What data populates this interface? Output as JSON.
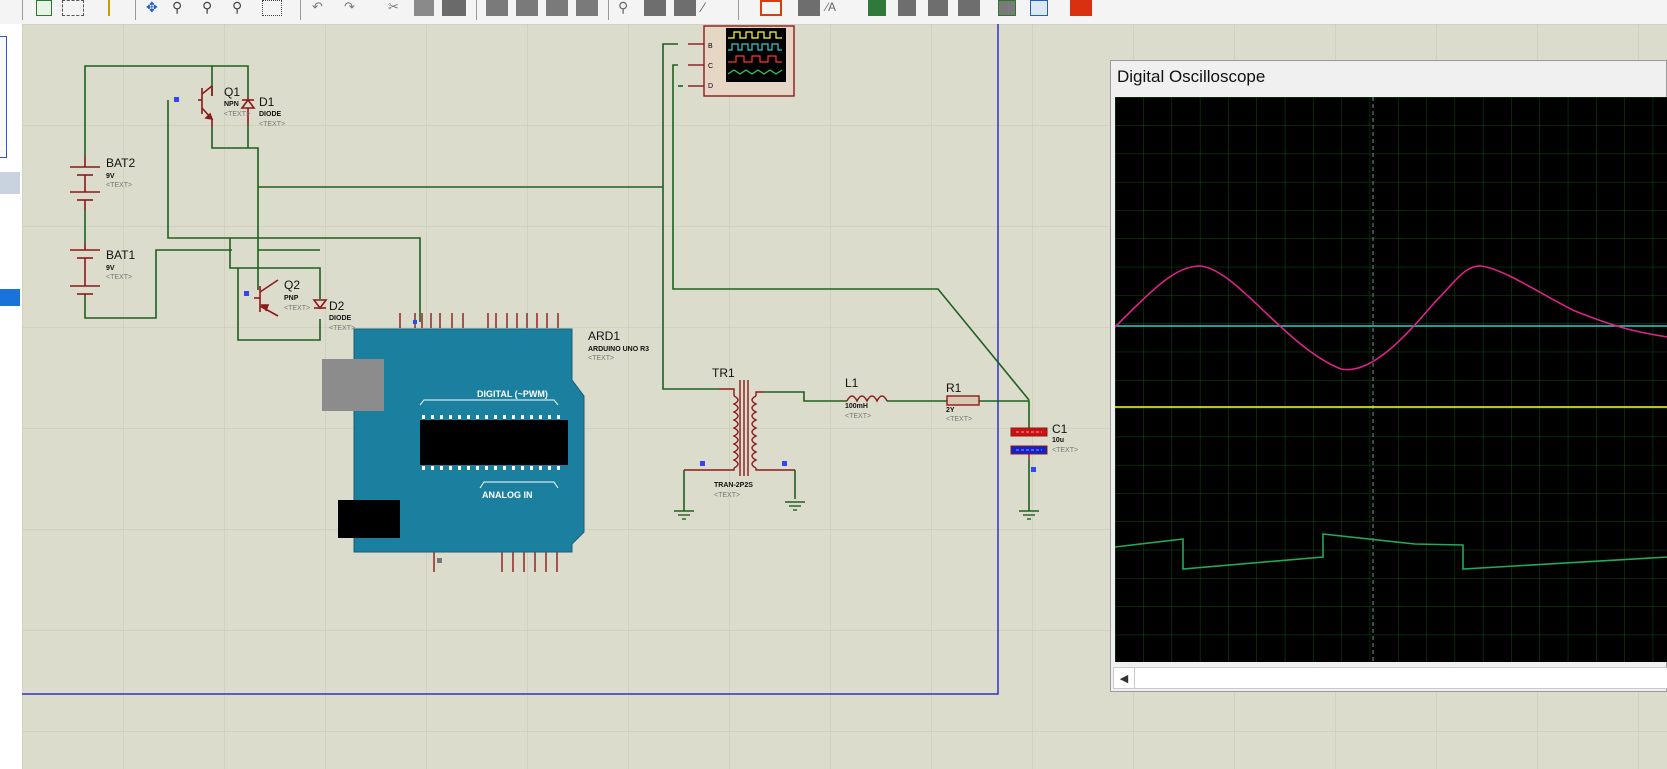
{
  "toolbar": {
    "icons": [
      "refresh-icon",
      "grid-icon",
      "origin-icon",
      "pan-icon",
      "zoom-in-icon",
      "zoom-out-icon",
      "zoom-all-icon",
      "zoom-area-icon",
      "undo-icon",
      "redo-icon",
      "cut-icon",
      "copy-icon",
      "paste-icon",
      "block-copy-icon",
      "block-move-icon",
      "block-rotate-icon",
      "block-delete-icon",
      "pick-device-icon",
      "make-device-icon",
      "package-icon",
      "decompose-icon",
      "wire-autorouter-icon",
      "search-tag-icon",
      "property-assignment-icon",
      "new-sheet-icon",
      "remove-sheet-icon",
      "goto-sheet-icon",
      "netlist-icon",
      "bom-icon",
      "erc-icon",
      "pdf-icon"
    ]
  },
  "colors": {
    "sheet_bg": "#dcdccc",
    "grid": "#c8c8b8",
    "wire": "#1f5f1f",
    "component": "#8b1a1a",
    "board_border": "#3333cc",
    "arduino": "#1b7fa0",
    "scope_ch_a": "#ffff33",
    "scope_ch_b": "#33cccc",
    "scope_ch_c": "#dd2288",
    "scope_ch_d": "#22aa55"
  },
  "schematic": {
    "labels": {
      "q1": "Q1",
      "q1_type": "NPN",
      "d1": "D1",
      "d1_type": "DIODE",
      "bat2": "BAT2",
      "bat2_val": "9V",
      "bat1": "BAT1",
      "bat1_val": "9V",
      "q2": "Q2",
      "q2_type": "PNP",
      "d2": "D2",
      "d2_type": "DIODE",
      "ard": "ARD1",
      "ard_type": "ARDUINO UNO R3",
      "ard_digital": "DIGITAL (~PWM)",
      "ard_analog": "ANALOG IN",
      "tr1": "TR1",
      "tr1_type": "TRAN-2P2S",
      "l1": "L1",
      "l1_val": "100mH",
      "r1": "R1",
      "r1_val": "2Y",
      "c1": "C1",
      "c1_val": "10u",
      "text_tag": "<TEXT>"
    }
  },
  "oscilloscope": {
    "title": "Digital Oscilloscope",
    "scroll_left": "◀"
  }
}
